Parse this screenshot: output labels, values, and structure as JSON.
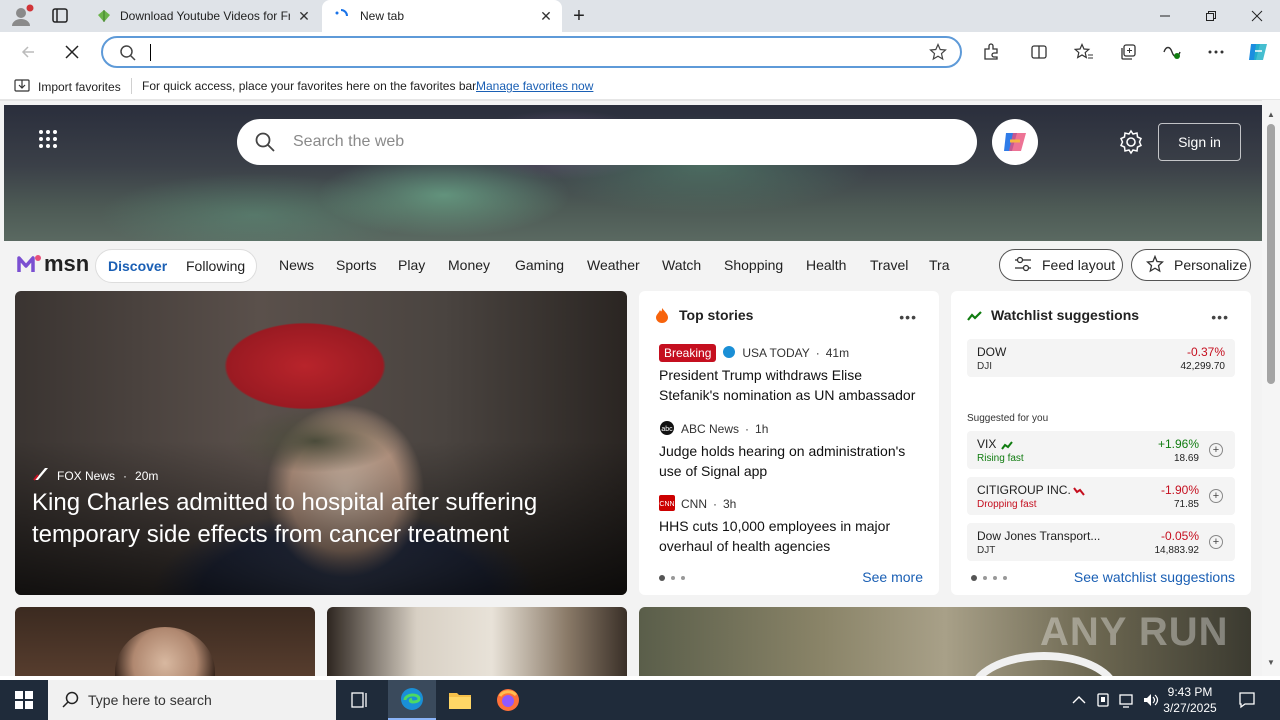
{
  "browser": {
    "tabs": [
      {
        "label": "Download Youtube Videos for Free"
      },
      {
        "label": "New tab"
      }
    ],
    "address": {
      "value": ""
    },
    "favorites_bar": {
      "import_label": "Import favorites",
      "message": "For quick access, place your favorites here on the favorites bar.",
      "manage_link": "Manage favorites now"
    }
  },
  "msn": {
    "search_placeholder": "Search the web",
    "signin": "Sign in",
    "logo": "msn",
    "pill": [
      "Discover",
      "Following"
    ],
    "nav": [
      "News",
      "Sports",
      "Play",
      "Money",
      "Gaming",
      "Weather",
      "Watch",
      "Shopping",
      "Health",
      "Travel",
      "Tra"
    ],
    "feed_layout": "Feed layout",
    "personalize": "Personalize"
  },
  "hero_story": {
    "source": "FOX News",
    "age": "20m",
    "headline": "King Charles admitted to hospital after suffering temporary side effects from cancer treatment"
  },
  "top_stories": {
    "title": "Top stories",
    "items": [
      {
        "badge": "Breaking",
        "source": "USA TODAY",
        "age": "41m",
        "title": "President Trump withdraws Elise Stefanik's nomination as UN ambassador"
      },
      {
        "source": "ABC News",
        "age": "1h",
        "title": "Judge holds hearing on administration's use of Signal app"
      },
      {
        "source": "CNN",
        "age": "3h",
        "title": "HHS cuts 10,000 employees in major overhaul of health agencies"
      }
    ],
    "see_more": "See more"
  },
  "watchlist": {
    "title": "Watchlist suggestions",
    "suggested_label": "Suggested for you",
    "see_link": "See watchlist suggestions",
    "stocks": [
      {
        "name": "DOW",
        "sub": "DJI",
        "change": "-0.37%",
        "value": "42,299.70"
      },
      {
        "name": "VIX",
        "sub": "Rising fast",
        "change": "+1.96%",
        "value": "18.69"
      },
      {
        "name": "CITIGROUP INC.",
        "sub": "Dropping fast",
        "change": "-1.90%",
        "value": "71.85"
      },
      {
        "name": "Dow Jones Transport...",
        "sub": "DJT",
        "change": "-0.05%",
        "value": "14,883.92"
      }
    ]
  },
  "watermark": "ANY RUN",
  "taskbar": {
    "search_placeholder": "Type here to search",
    "time": "9:43 PM",
    "date": "3/27/2025"
  }
}
